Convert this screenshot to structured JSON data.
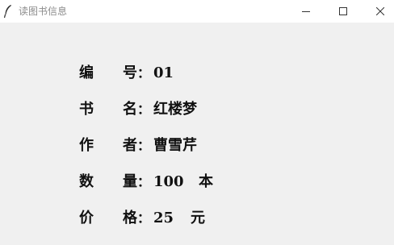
{
  "window": {
    "title": "读图书信息",
    "icon": "feather-icon",
    "controls": [
      "minimize-icon",
      "maximize-icon",
      "close-icon"
    ]
  },
  "book": {
    "id": {
      "label_left": "编",
      "label_right": "号",
      "colon": "：",
      "value": "01"
    },
    "name": {
      "label_left": "书",
      "label_right": "名",
      "colon": "：",
      "value": "红楼梦"
    },
    "author": {
      "label_left": "作",
      "label_right": "者",
      "colon": "：",
      "value": "曹雪芹"
    },
    "quantity": {
      "label_left": "数",
      "label_right": "量",
      "colon": "：",
      "value": "100",
      "unit": "本"
    },
    "price": {
      "label_left": "价",
      "label_right": "格",
      "colon": "：",
      "value": "25",
      "unit": "元"
    }
  }
}
